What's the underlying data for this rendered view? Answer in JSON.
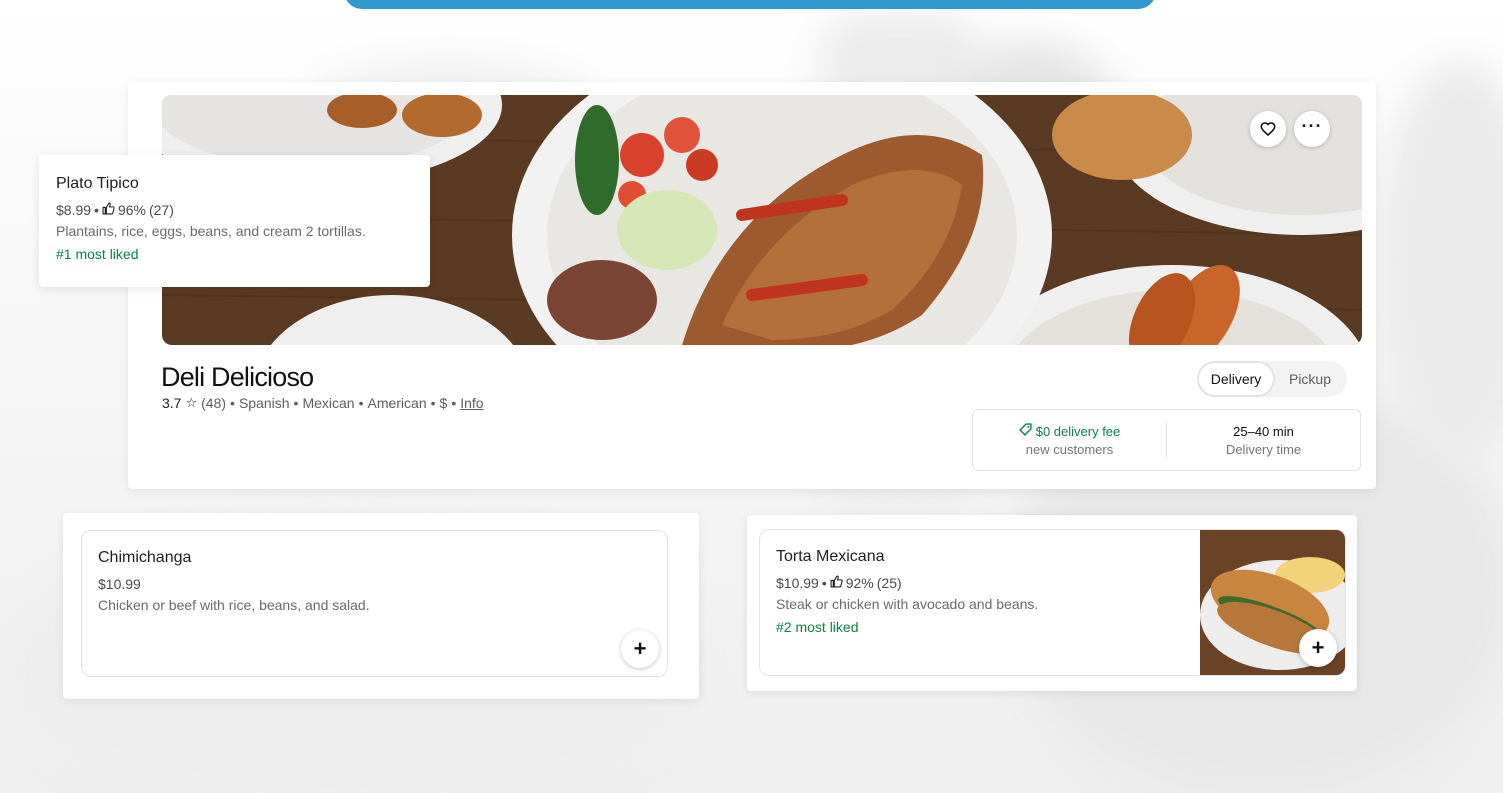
{
  "store": {
    "name": "Deli Delicioso",
    "rating": "3.7",
    "rating_count": "(48)",
    "cuisines": [
      "Spanish",
      "Mexican",
      "American",
      "$"
    ],
    "info_link": "Info",
    "icons": {
      "favorite": "heart-icon",
      "more": "ellipsis-icon",
      "star": "star-icon"
    }
  },
  "mode": {
    "delivery_label": "Delivery",
    "pickup_label": "Pickup",
    "selected": "Delivery"
  },
  "delivery": {
    "fee_label": "$0 delivery fee",
    "fee_sub": "new customers",
    "time_label": "25–40 min",
    "time_sub": "Delivery time",
    "icons": {
      "fee": "tag-icon"
    }
  },
  "featured_popup": {
    "title": "Plato Tipico",
    "price": "$8.99",
    "like_pct": "96%",
    "like_count": "(27)",
    "description": "Plantains, rice, eggs, beans, and cream 2 tortillas.",
    "rank": "#1 most liked"
  },
  "menu_items": [
    {
      "title": "Chimichanga",
      "price": "$10.99",
      "description": "Chicken or beef with rice, beans, and salad.",
      "add_label": "+"
    },
    {
      "title": "Torta Mexicana",
      "price": "$10.99",
      "like_pct": "92%",
      "like_count": "(25)",
      "description": "Steak or chicken with avocado and beans.",
      "rank": "#2 most liked",
      "add_label": "+"
    }
  ],
  "colors": {
    "accent_bar": "#3399cc",
    "positive": "#0e8345",
    "text_primary": "#1f1f1f",
    "text_secondary": "#5e5e5e"
  }
}
